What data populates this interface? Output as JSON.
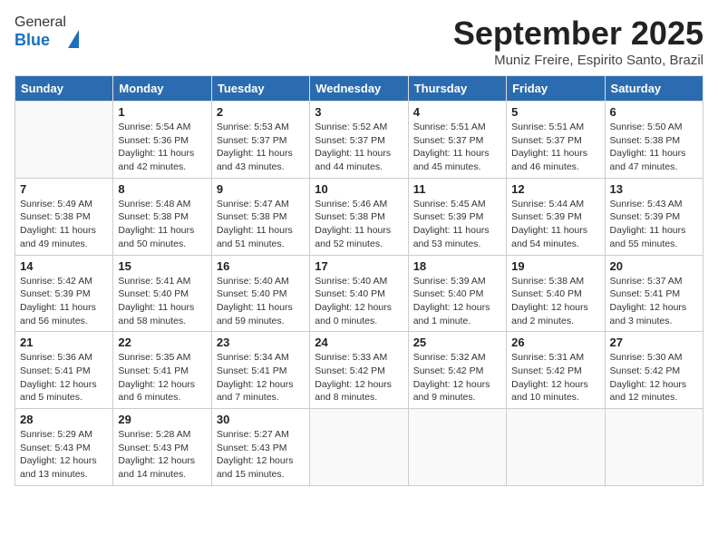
{
  "header": {
    "logo_line1": "General",
    "logo_line2": "Blue",
    "month": "September 2025",
    "location": "Muniz Freire, Espirito Santo, Brazil"
  },
  "days_of_week": [
    "Sunday",
    "Monday",
    "Tuesday",
    "Wednesday",
    "Thursday",
    "Friday",
    "Saturday"
  ],
  "weeks": [
    [
      {
        "day": "",
        "info": ""
      },
      {
        "day": "1",
        "info": "Sunrise: 5:54 AM\nSunset: 5:36 PM\nDaylight: 11 hours\nand 42 minutes."
      },
      {
        "day": "2",
        "info": "Sunrise: 5:53 AM\nSunset: 5:37 PM\nDaylight: 11 hours\nand 43 minutes."
      },
      {
        "day": "3",
        "info": "Sunrise: 5:52 AM\nSunset: 5:37 PM\nDaylight: 11 hours\nand 44 minutes."
      },
      {
        "day": "4",
        "info": "Sunrise: 5:51 AM\nSunset: 5:37 PM\nDaylight: 11 hours\nand 45 minutes."
      },
      {
        "day": "5",
        "info": "Sunrise: 5:51 AM\nSunset: 5:37 PM\nDaylight: 11 hours\nand 46 minutes."
      },
      {
        "day": "6",
        "info": "Sunrise: 5:50 AM\nSunset: 5:38 PM\nDaylight: 11 hours\nand 47 minutes."
      }
    ],
    [
      {
        "day": "7",
        "info": "Sunrise: 5:49 AM\nSunset: 5:38 PM\nDaylight: 11 hours\nand 49 minutes."
      },
      {
        "day": "8",
        "info": "Sunrise: 5:48 AM\nSunset: 5:38 PM\nDaylight: 11 hours\nand 50 minutes."
      },
      {
        "day": "9",
        "info": "Sunrise: 5:47 AM\nSunset: 5:38 PM\nDaylight: 11 hours\nand 51 minutes."
      },
      {
        "day": "10",
        "info": "Sunrise: 5:46 AM\nSunset: 5:38 PM\nDaylight: 11 hours\nand 52 minutes."
      },
      {
        "day": "11",
        "info": "Sunrise: 5:45 AM\nSunset: 5:39 PM\nDaylight: 11 hours\nand 53 minutes."
      },
      {
        "day": "12",
        "info": "Sunrise: 5:44 AM\nSunset: 5:39 PM\nDaylight: 11 hours\nand 54 minutes."
      },
      {
        "day": "13",
        "info": "Sunrise: 5:43 AM\nSunset: 5:39 PM\nDaylight: 11 hours\nand 55 minutes."
      }
    ],
    [
      {
        "day": "14",
        "info": "Sunrise: 5:42 AM\nSunset: 5:39 PM\nDaylight: 11 hours\nand 56 minutes."
      },
      {
        "day": "15",
        "info": "Sunrise: 5:41 AM\nSunset: 5:40 PM\nDaylight: 11 hours\nand 58 minutes."
      },
      {
        "day": "16",
        "info": "Sunrise: 5:40 AM\nSunset: 5:40 PM\nDaylight: 11 hours\nand 59 minutes."
      },
      {
        "day": "17",
        "info": "Sunrise: 5:40 AM\nSunset: 5:40 PM\nDaylight: 12 hours\nand 0 minutes."
      },
      {
        "day": "18",
        "info": "Sunrise: 5:39 AM\nSunset: 5:40 PM\nDaylight: 12 hours\nand 1 minute."
      },
      {
        "day": "19",
        "info": "Sunrise: 5:38 AM\nSunset: 5:40 PM\nDaylight: 12 hours\nand 2 minutes."
      },
      {
        "day": "20",
        "info": "Sunrise: 5:37 AM\nSunset: 5:41 PM\nDaylight: 12 hours\nand 3 minutes."
      }
    ],
    [
      {
        "day": "21",
        "info": "Sunrise: 5:36 AM\nSunset: 5:41 PM\nDaylight: 12 hours\nand 5 minutes."
      },
      {
        "day": "22",
        "info": "Sunrise: 5:35 AM\nSunset: 5:41 PM\nDaylight: 12 hours\nand 6 minutes."
      },
      {
        "day": "23",
        "info": "Sunrise: 5:34 AM\nSunset: 5:41 PM\nDaylight: 12 hours\nand 7 minutes."
      },
      {
        "day": "24",
        "info": "Sunrise: 5:33 AM\nSunset: 5:42 PM\nDaylight: 12 hours\nand 8 minutes."
      },
      {
        "day": "25",
        "info": "Sunrise: 5:32 AM\nSunset: 5:42 PM\nDaylight: 12 hours\nand 9 minutes."
      },
      {
        "day": "26",
        "info": "Sunrise: 5:31 AM\nSunset: 5:42 PM\nDaylight: 12 hours\nand 10 minutes."
      },
      {
        "day": "27",
        "info": "Sunrise: 5:30 AM\nSunset: 5:42 PM\nDaylight: 12 hours\nand 12 minutes."
      }
    ],
    [
      {
        "day": "28",
        "info": "Sunrise: 5:29 AM\nSunset: 5:43 PM\nDaylight: 12 hours\nand 13 minutes."
      },
      {
        "day": "29",
        "info": "Sunrise: 5:28 AM\nSunset: 5:43 PM\nDaylight: 12 hours\nand 14 minutes."
      },
      {
        "day": "30",
        "info": "Sunrise: 5:27 AM\nSunset: 5:43 PM\nDaylight: 12 hours\nand 15 minutes."
      },
      {
        "day": "",
        "info": ""
      },
      {
        "day": "",
        "info": ""
      },
      {
        "day": "",
        "info": ""
      },
      {
        "day": "",
        "info": ""
      }
    ]
  ]
}
